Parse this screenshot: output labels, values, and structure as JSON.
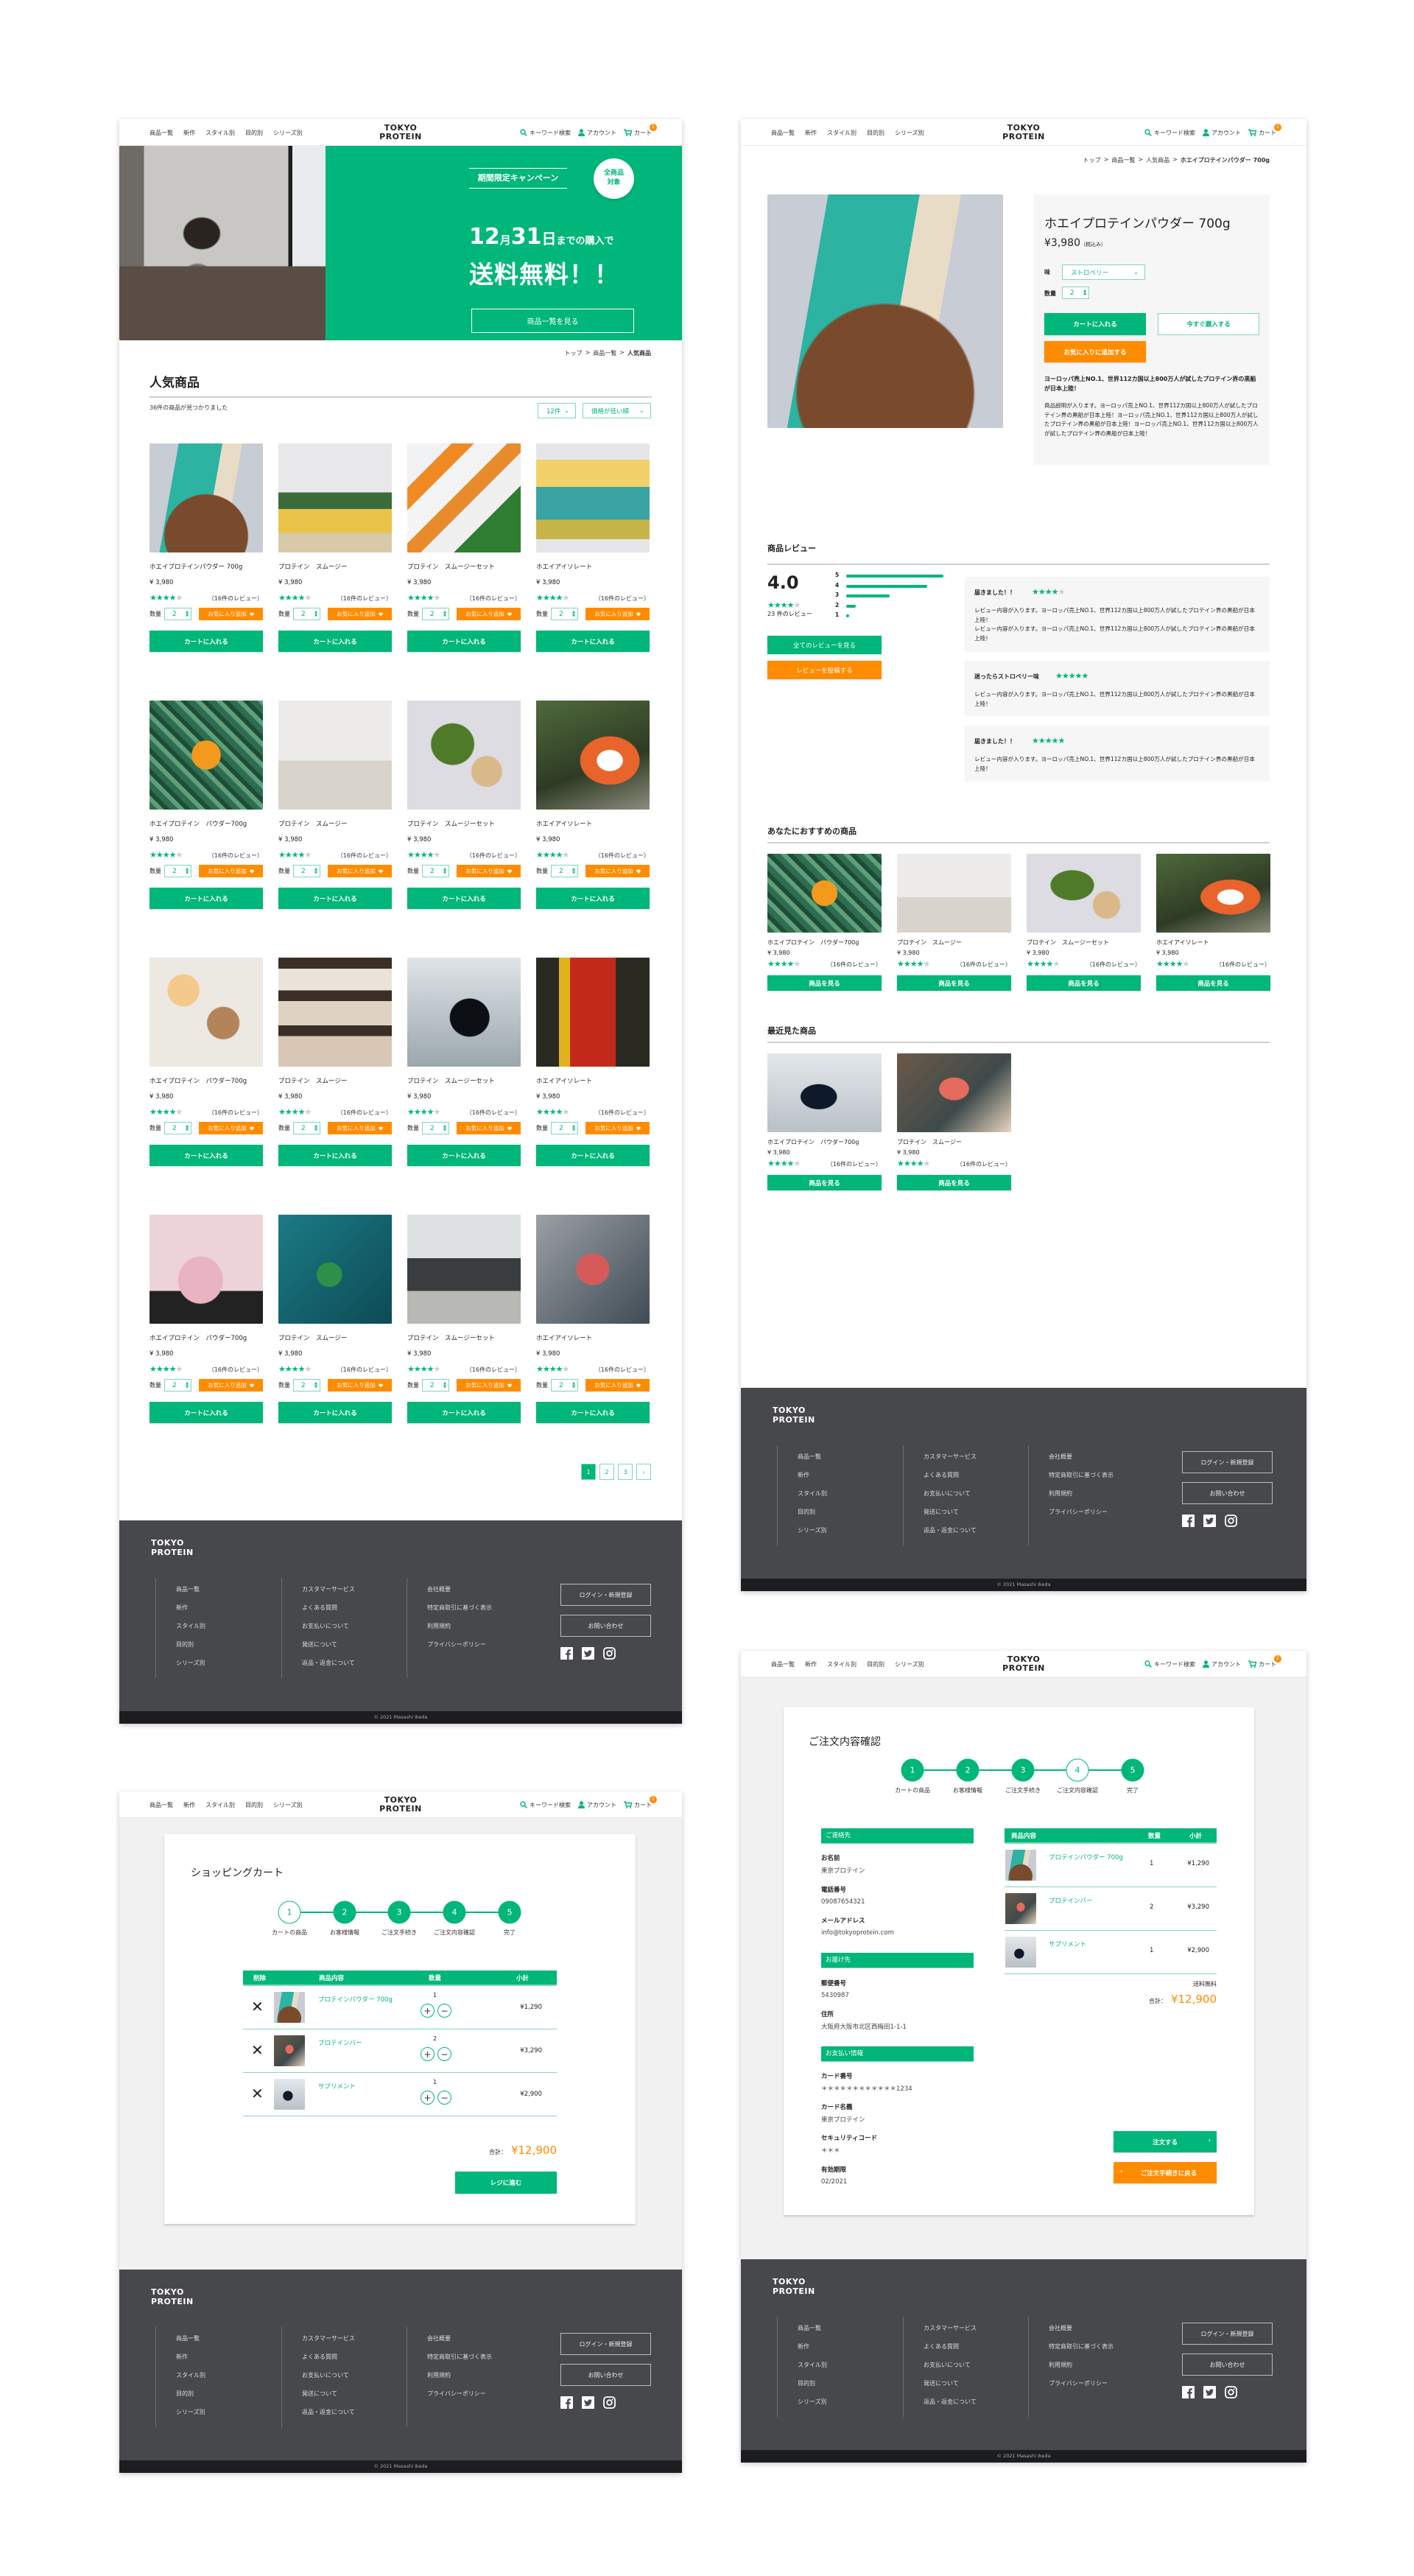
{
  "brand": {
    "line1": "TOKYO",
    "line2": "PROTEIN"
  },
  "colors": {
    "accent": "#00b67a",
    "accent_light": "#7fd8b5",
    "orange": "#ff8c00",
    "footer": "#47484c",
    "footer_bottom": "#1c1d20"
  },
  "header": {
    "nav": [
      "商品一覧",
      "新作",
      "スタイル別",
      "目的別",
      "シリーズ別"
    ],
    "search": "キーワード検索",
    "account": "アカウント",
    "cart": "カート",
    "cart_badge": "2",
    "icons": [
      "search-icon",
      "user-icon",
      "cart-icon"
    ]
  },
  "footer": {
    "columns": [
      [
        "商品一覧",
        "新作",
        "スタイル別",
        "目的別",
        "シリーズ別"
      ],
      [
        "カスタマーサービス",
        "よくある質問",
        "お支払いについて",
        "発送について",
        "返品・返金について"
      ],
      [
        "会社概要",
        "特定商取引に基づく表示",
        "利用規約",
        "プライバシーポリシー"
      ]
    ],
    "login": "ログイン・新規登録",
    "contact": "お問い合わせ",
    "social": [
      "facebook-icon",
      "twitter-icon",
      "instagram-icon"
    ],
    "copyright": "© 2021 Masashi Ikeda"
  },
  "list_page": {
    "hero": {
      "campaign": "期間限定キャンペーン",
      "badge": [
        "全商品",
        "対象"
      ],
      "month": "12",
      "month_unit": "月",
      "day": "31",
      "day_unit": "日",
      "date_suffix": "までの購入で",
      "headline": "送料無料！！",
      "button": "商品一覧を見る"
    },
    "breadcrumb": [
      "トップ",
      "商品一覧",
      "人気商品"
    ],
    "title": "人気商品",
    "count": "36件の商品が見つかりました",
    "per_page": "12件",
    "sort": "価格が低い順",
    "qty_label": "数量",
    "qty": "2",
    "fav": "お気に入り追加",
    "cart_button": "カートに入れる",
    "products": [
      {
        "name": "ホエイプロテインパウダー 700g",
        "price": "¥ 3,980",
        "rating": 4,
        "reviews": "（16件のレビュー）"
      },
      {
        "name": "プロテイン　スムージー",
        "price": "¥ 3,980",
        "rating": 4,
        "reviews": "（16件のレビュー）"
      },
      {
        "name": "プロテイン　スムージーセット",
        "price": "¥ 3,980",
        "rating": 4,
        "reviews": "（16件のレビュー）"
      },
      {
        "name": "ホエイアイソレート",
        "price": "¥ 3,980",
        "rating": 4,
        "reviews": "（16件のレビュー）"
      },
      {
        "name": "ホエイプロテイン　パウダー700g",
        "price": "¥ 3,980",
        "rating": 4,
        "reviews": "（16件のレビュー）"
      },
      {
        "name": "プロテイン　スムージー",
        "price": "¥ 3,980",
        "rating": 4,
        "reviews": "（16件のレビュー）"
      },
      {
        "name": "プロテイン　スムージーセット",
        "price": "¥ 3,980",
        "rating": 4,
        "reviews": "（16件のレビュー）"
      },
      {
        "name": "ホエイアイソレート",
        "price": "¥ 3,980",
        "rating": 4,
        "reviews": "（16件のレビュー）"
      },
      {
        "name": "ホエイプロテイン　パウダー700g",
        "price": "¥ 3,980",
        "rating": 4,
        "reviews": "（16件のレビュー）"
      },
      {
        "name": "プロテイン　スムージー",
        "price": "¥ 3,980",
        "rating": 4,
        "reviews": "（16件のレビュー）"
      },
      {
        "name": "プロテイン　スムージーセット",
        "price": "¥ 3,980",
        "rating": 4,
        "reviews": "（16件のレビュー）"
      },
      {
        "name": "ホエイアイソレート",
        "price": "¥ 3,980",
        "rating": 4,
        "reviews": "（16件のレビュー）"
      },
      {
        "name": "ホエイプロテイン　パウダー700g",
        "price": "¥ 3,980",
        "rating": 4,
        "reviews": "（16件のレビュー）"
      },
      {
        "name": "プロテイン　スムージー",
        "price": "¥ 3,980",
        "rating": 4,
        "reviews": "（16件のレビュー）"
      },
      {
        "name": "プロテイン　スムージーセット",
        "price": "¥ 3,980",
        "rating": 4,
        "reviews": "（16件のレビュー）"
      },
      {
        "name": "ホエイアイソレート",
        "price": "¥ 3,980",
        "rating": 4,
        "reviews": "（16件のレビュー）"
      }
    ],
    "pagination": [
      "1",
      "2",
      "3",
      "›"
    ],
    "current_page": 1
  },
  "detail_page": {
    "breadcrumb": [
      "トップ",
      "商品一覧",
      "人気商品",
      "ホエイプロテインパウダー 700g"
    ],
    "title": "ホエイプロテインパウダー 700g",
    "price": "¥3,980",
    "tax": "（税込み）",
    "flavor_label": "味",
    "flavor": "ストロベリー",
    "qty_label": "数量",
    "qty": "2",
    "cart_button": "カートに入れる",
    "buy_now": "今すぐ購入する",
    "fav_button": "お気に入りに追加する",
    "lead": "ヨーロッパ売上NO.1、世界112カ国以上800万人が試したプロテイン界の黒船が日本上陸！",
    "description": "商品説明が入ります。ヨーロッパ売上NO.1、世界112カ国以上800万人が試したプロテイン界の黒船が日本上陸！ヨーロッパ売上NO.1、世界112カ国以上800万人が試したプロテイン界の黒船が日本上陸！ヨーロッパ売上NO.1、世界112カ国以上800万人が試したプロテイン界の黒船が日本上陸！",
    "reviews": {
      "title": "商品レビュー",
      "average": "4.0",
      "average_rating": 4,
      "count": "23 件のレビュー",
      "distribution": [
        {
          "stars": "5",
          "share": 1.0
        },
        {
          "stars": "4",
          "share": 0.83
        },
        {
          "stars": "3",
          "share": 0.45
        },
        {
          "stars": "2",
          "share": 0.1
        },
        {
          "stars": "1",
          "share": 0.02
        }
      ],
      "all_button": "全てのレビューを見る",
      "post_button": "レビューを投稿する",
      "items": [
        {
          "title": "届きました！！",
          "rating": 4,
          "body": [
            "レビュー内容が入ります。ヨーロッパ売上NO.1、世界112カ国以上800万人が試したプロテイン界の黒船が日本上陸！",
            "レビュー内容が入ります。ヨーロッパ売上NO.1、世界112カ国以上800万人が試したプロテイン界の黒船が日本上陸！"
          ]
        },
        {
          "title": "迷ったらストロベリー味",
          "rating": 5,
          "body": [
            "レビュー内容が入ります。ヨーロッパ売上NO.1、世界112カ国以上800万人が試したプロテイン界の黒船が日本上陸！"
          ]
        },
        {
          "title": "届きました！！",
          "rating": 5,
          "body": [
            "レビュー内容が入ります。ヨーロッパ売上NO.1、世界112カ国以上800万人が試したプロテイン界の黒船が日本上陸！"
          ]
        }
      ]
    },
    "recommended": {
      "title": "あなたにおすすめの商品",
      "button": "商品を見る",
      "items": [
        {
          "name": "ホエイプロテイン　パウダー700g",
          "price": "¥ 3,980",
          "rating": 4,
          "reviews": "（16件のレビュー）"
        },
        {
          "name": "プロテイン　スムージー",
          "price": "¥ 3,980",
          "rating": 4,
          "reviews": "（16件のレビュー）"
        },
        {
          "name": "プロテイン　スムージーセット",
          "price": "¥ 3,980",
          "rating": 4,
          "reviews": "（16件のレビュー）"
        },
        {
          "name": "ホエイアイソレート",
          "price": "¥ 3,980",
          "rating": 4,
          "reviews": "（16件のレビュー）"
        }
      ]
    },
    "recent": {
      "title": "最近見た商品",
      "button": "商品を見る",
      "items": [
        {
          "name": "ホエイプロテイン　パウダー700g",
          "price": "¥ 3,980",
          "rating": 4,
          "reviews": "（16件のレビュー）"
        },
        {
          "name": "プロテイン　スムージー",
          "price": "¥ 3,980",
          "rating": 4,
          "reviews": "（16件のレビュー）"
        }
      ]
    }
  },
  "steps": [
    "カートの商品",
    "お客様情報",
    "ご注文手続き",
    "ご注文内容確認",
    "完了"
  ],
  "cart_page": {
    "title": "ショッピングカート",
    "current_step": 1,
    "headers": [
      "削除",
      "商品内容",
      "数量",
      "小計"
    ],
    "items": [
      {
        "name": "プロテインパウダー 700g",
        "qty": "1",
        "subtotal": "¥1,290"
      },
      {
        "name": "プロテインバー",
        "qty": "2",
        "subtotal": "¥3,290"
      },
      {
        "name": "サプリメント",
        "qty": "1",
        "subtotal": "¥2,900"
      }
    ],
    "total_label": "合計：",
    "total": "¥12,900",
    "checkout": "レジに進む"
  },
  "confirm_page": {
    "title": "ご注文内容確認",
    "current_step": 4,
    "contact": {
      "heading": "ご連絡先",
      "fields": [
        {
          "label": "お名前",
          "value": "東京プロテイン"
        },
        {
          "label": "電話番号",
          "value": "09087654321"
        },
        {
          "label": "メールアドレス",
          "value": "info@tokyoprotein.com"
        }
      ]
    },
    "shipping": {
      "heading": "お届け先",
      "fields": [
        {
          "label": "郵便番号",
          "value": "5430987"
        },
        {
          "label": "住所",
          "value": "大阪府大阪市北区西梅田1-1-1"
        }
      ]
    },
    "payment": {
      "heading": "お支払い情報",
      "fields": [
        {
          "label": "カード番号",
          "value": "＊＊＊＊＊＊＊＊＊＊＊＊1234"
        },
        {
          "label": "カード名義",
          "value": "東京プロテイン"
        },
        {
          "label": "セキュリティコード",
          "value": "＊＊＊"
        },
        {
          "label": "有効期限",
          "value": "02/2021"
        }
      ]
    },
    "headers": [
      "商品内容",
      "数量",
      "小計"
    ],
    "items": [
      {
        "name": "プロテインパウダー 700g",
        "qty": "1",
        "subtotal": "¥1,290"
      },
      {
        "name": "プロテインバー",
        "qty": "2",
        "subtotal": "¥3,290"
      },
      {
        "name": "サプリメント",
        "qty": "1",
        "subtotal": "¥2,900"
      }
    ],
    "shipping_note": "送料無料",
    "total_label": "合計：",
    "total": "¥12,900",
    "order_button": "注文する",
    "back_button": "ご注文手続きに戻る"
  }
}
